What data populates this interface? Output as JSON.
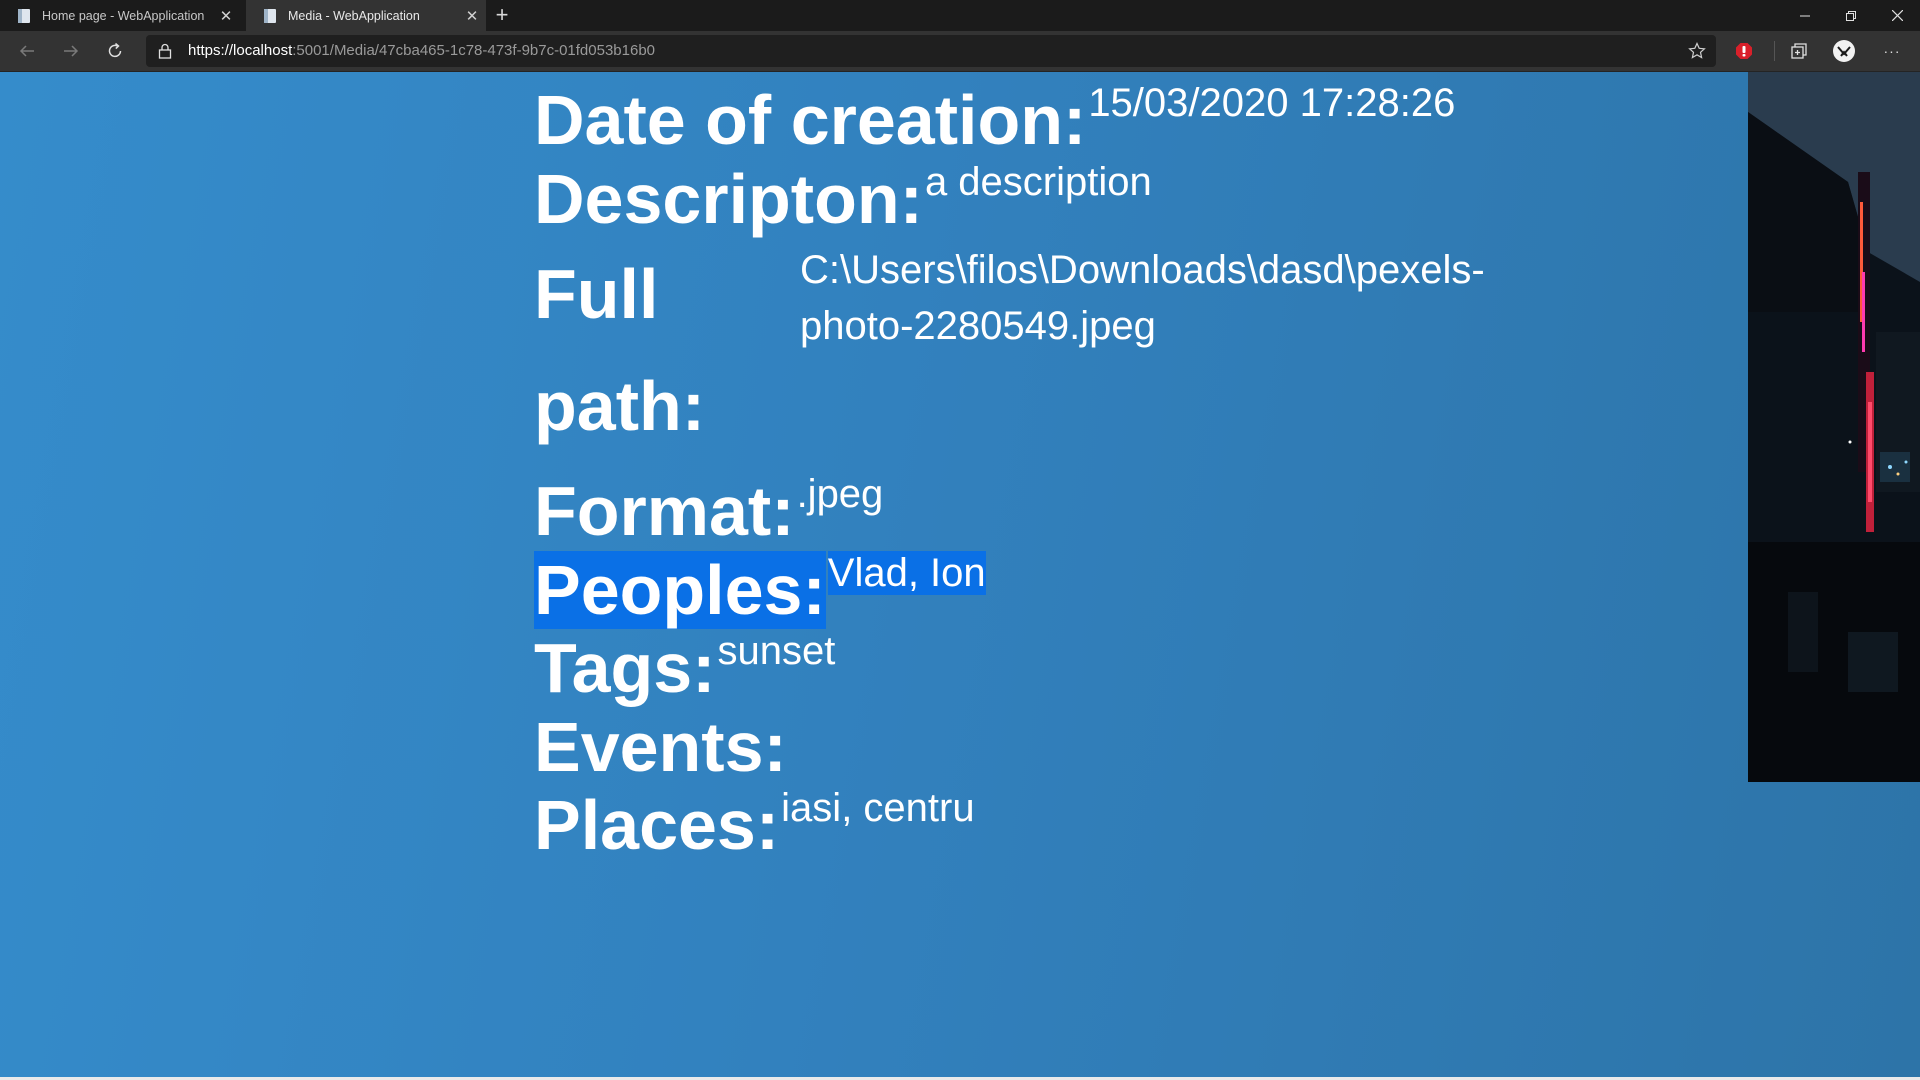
{
  "browser": {
    "tabs": [
      {
        "title": "Home page - WebApplication",
        "active": false
      },
      {
        "title": "Media - WebApplication",
        "active": true
      }
    ],
    "new_tab_label": "+",
    "url": {
      "scheme": "https://",
      "host": "localhost",
      "path": ":5001/Media/47cba465-1c78-473f-9b7c-01fd053b16b0"
    },
    "icons": {
      "back": "arrow-left-icon",
      "forward": "arrow-right-icon",
      "refresh": "refresh-icon",
      "lock": "lock-icon",
      "favorite": "star-icon",
      "extension": "adblock-extension-icon",
      "collections": "collections-icon",
      "profile": "avatar-icon",
      "menu": "more-icon"
    },
    "menu_label": "···"
  },
  "media": {
    "date_label": "Date of creation:",
    "date_value": "15/03/2020 17:28:26",
    "description_label": "Descripton:",
    "description_value": "a description",
    "path_label": "Full path:",
    "path_value": "C:\\Users\\filos\\Downloads\\dasd\\pexels-photo-2280549.jpeg",
    "format_label": "Format:",
    "format_value": ".jpeg",
    "peoples_label": "Peoples:",
    "peoples_value": "Vlad, Ion",
    "tags_label": "Tags:",
    "tags_value": "sunset",
    "events_label": "Events:",
    "events_value": "",
    "places_label": "Places:",
    "places_value": "iasi, centru"
  },
  "colors": {
    "page_background": "#3281be",
    "selection": "#0a70e6",
    "text": "#ffffff"
  }
}
